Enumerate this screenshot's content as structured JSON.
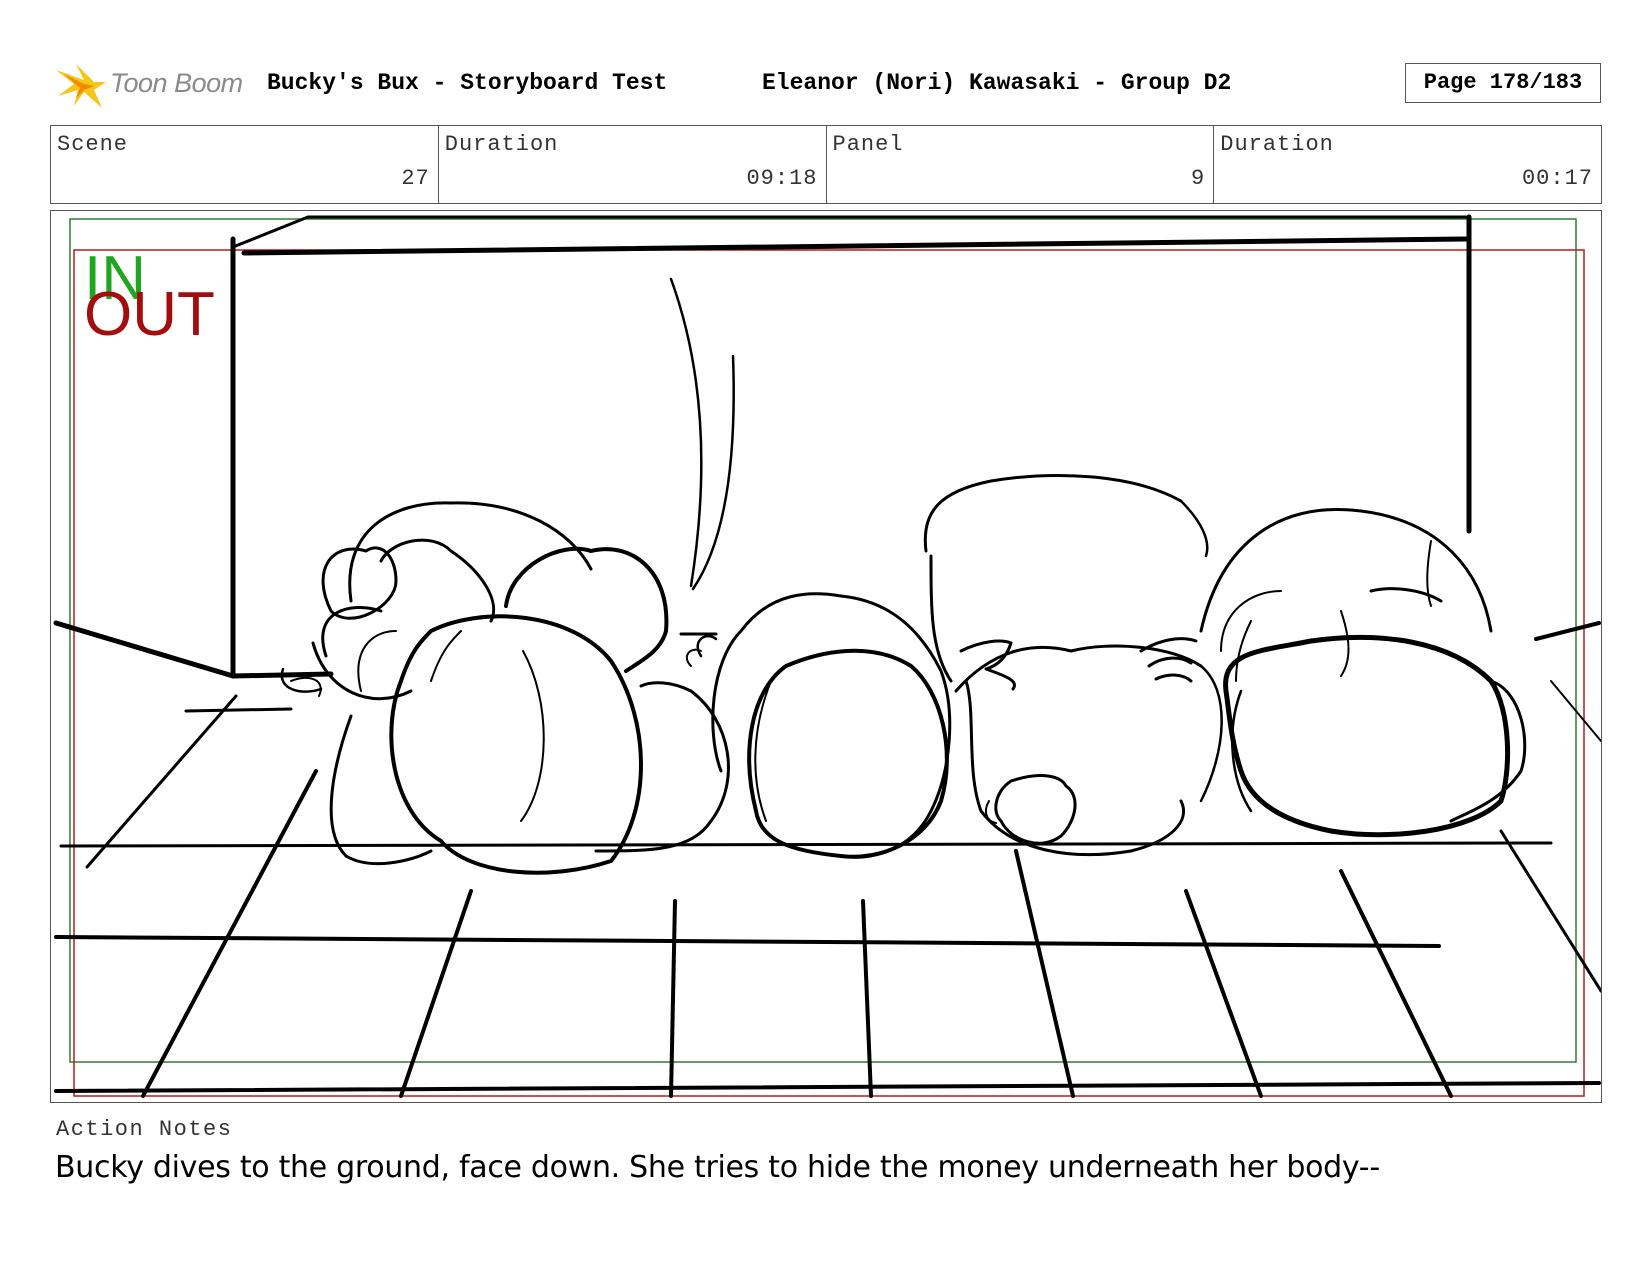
{
  "header": {
    "logo_text": "Toon Boom",
    "project_title": "Bucky's Bux - Storyboard Test",
    "artist": "Eleanor (Nori) Kawasaki - Group D2",
    "page": "Page 178/183"
  },
  "info": {
    "scene_label": "Scene",
    "scene_value": "27",
    "scene_duration_label": "Duration",
    "scene_duration_value": "09:18",
    "panel_label": "Panel",
    "panel_value": "9",
    "panel_duration_label": "Duration",
    "panel_duration_value": "00:17"
  },
  "panel": {
    "in_label": "IN",
    "out_label": "OUT",
    "colors": {
      "in_frame": "#2e7d32",
      "out_frame": "#b71c1c",
      "in_text": "#1fa51f",
      "out_text": "#a30d0d"
    }
  },
  "notes": {
    "label": "Action Notes",
    "text": "Bucky dives to the ground, face down. She tries to hide the money underneath her body--"
  }
}
